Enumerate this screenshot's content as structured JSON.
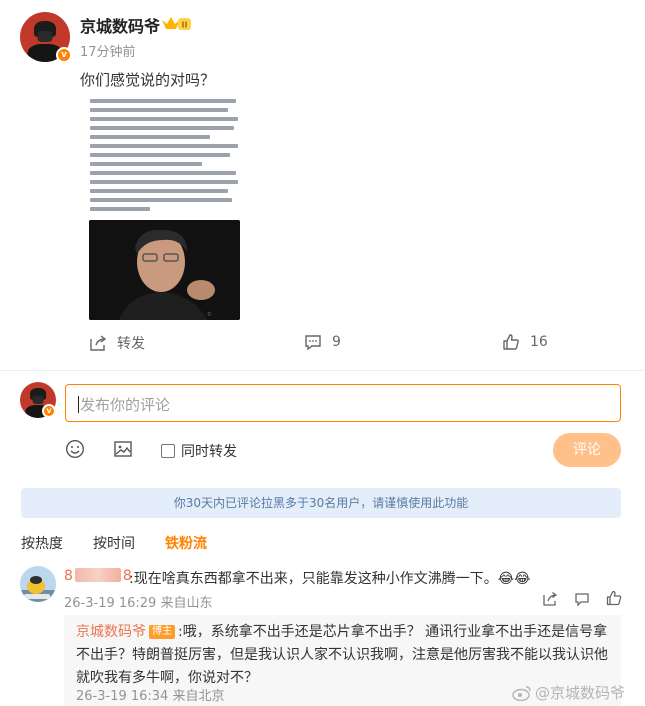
{
  "post": {
    "author": "京城数码爷",
    "time": "17分钟前",
    "text": "你们感觉说的对吗？",
    "repost_label": "转发",
    "comment_count": "9",
    "like_count": "16"
  },
  "composer": {
    "placeholder": "发布你的评论",
    "repost_check_label": "同时转发",
    "submit_label": "评论"
  },
  "notice": "你30天内已评论拉黑多于30名用户，请谨慎使用此功能",
  "sort_tabs": [
    "按热度",
    "按时间",
    "铁粉流"
  ],
  "comment": {
    "user_prefix": "8",
    "user_suffix": "8",
    "text": ":现在啥真东西都拿不出来，只能靠发这种小作文沸腾一下。😂😂",
    "meta": "26-3-19 16:29 来自山东"
  },
  "reply": {
    "name": "京城数码爷",
    "tag": "博主",
    "text": ":哦，系统拿不出手还是芯片拿不出手？ 通讯行业拿不出手还是信号拿不出手？特朗普挺厉害，但是我认识人家不认识我啊，注意是他厉害我不能以我认识他就吹我有多牛啊，你说对不？",
    "meta": "26-3-19 16:34 来自北京"
  },
  "watermark": "@京城数码爷",
  "colors": {
    "accent": "#ff8200",
    "link": "#eb7350",
    "notice_bg": "#e4eefa"
  }
}
